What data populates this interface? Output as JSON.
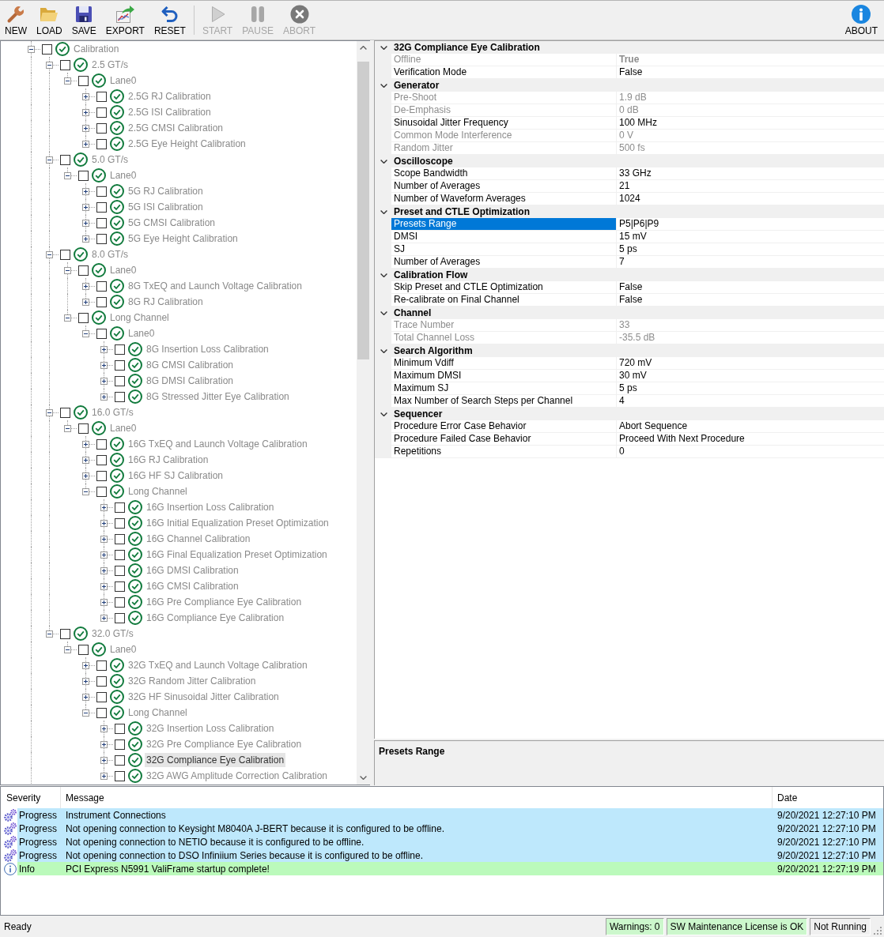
{
  "toolbar": {
    "groups": [
      [
        {
          "label": "NEW",
          "disabled": false
        },
        {
          "label": "LOAD",
          "disabled": false
        },
        {
          "label": "SAVE",
          "disabled": false
        },
        {
          "label": "EXPORT",
          "disabled": false
        },
        {
          "label": "RESET",
          "disabled": false
        }
      ],
      [
        {
          "label": "START",
          "disabled": true
        },
        {
          "label": "PAUSE",
          "disabled": true
        },
        {
          "label": "ABORT",
          "disabled": true
        }
      ]
    ],
    "right": [
      {
        "label": "ABOUT",
        "disabled": false
      }
    ]
  },
  "tree": {
    "nodes": [
      {
        "label": "Calibration",
        "checked": false,
        "expanded": true,
        "selected": false,
        "passed": true,
        "children": [
          {
            "label": "2.5 GT/s",
            "checked": false,
            "expanded": true,
            "selected": false,
            "passed": true,
            "children": [
              {
                "label": "Lane0",
                "checked": false,
                "expanded": true,
                "selected": false,
                "passed": true,
                "children": [
                  {
                    "label": "2.5G RJ Calibration",
                    "checked": false,
                    "expanded": false,
                    "selected": false,
                    "passed": true
                  },
                  {
                    "label": "2.5G ISI Calibration",
                    "checked": false,
                    "expanded": false,
                    "selected": false,
                    "passed": true
                  },
                  {
                    "label": "2.5G CMSI Calibration",
                    "checked": false,
                    "expanded": false,
                    "selected": false,
                    "passed": true
                  },
                  {
                    "label": "2.5G Eye Height Calibration",
                    "checked": false,
                    "expanded": false,
                    "selected": false,
                    "passed": true
                  }
                ]
              }
            ]
          },
          {
            "label": "5.0 GT/s",
            "checked": false,
            "expanded": true,
            "selected": false,
            "passed": true,
            "children": [
              {
                "label": "Lane0",
                "checked": false,
                "expanded": true,
                "selected": false,
                "passed": true,
                "children": [
                  {
                    "label": "5G RJ Calibration",
                    "checked": false,
                    "expanded": false,
                    "selected": false,
                    "passed": true
                  },
                  {
                    "label": "5G ISI Calibration",
                    "checked": false,
                    "expanded": false,
                    "selected": false,
                    "passed": true
                  },
                  {
                    "label": "5G CMSI Calibration",
                    "checked": false,
                    "expanded": false,
                    "selected": false,
                    "passed": true
                  },
                  {
                    "label": "5G Eye Height Calibration",
                    "checked": false,
                    "expanded": false,
                    "selected": false,
                    "passed": true
                  }
                ]
              }
            ]
          },
          {
            "label": "8.0 GT/s",
            "checked": false,
            "expanded": true,
            "selected": false,
            "passed": true,
            "children": [
              {
                "label": "Lane0",
                "checked": false,
                "expanded": true,
                "selected": false,
                "passed": true,
                "children": [
                  {
                    "label": "8G TxEQ and Launch Voltage Calibration",
                    "checked": false,
                    "expanded": false,
                    "selected": false,
                    "passed": true
                  },
                  {
                    "label": "8G RJ Calibration",
                    "checked": false,
                    "expanded": false,
                    "selected": false,
                    "passed": true
                  }
                ]
              },
              {
                "label": "Long Channel",
                "checked": false,
                "expanded": true,
                "selected": false,
                "passed": true,
                "children": [
                  {
                    "label": "Lane0",
                    "checked": false,
                    "expanded": true,
                    "selected": false,
                    "passed": true,
                    "children": [
                      {
                        "label": "8G Insertion Loss Calibration",
                        "checked": false,
                        "expanded": false,
                        "selected": false,
                        "passed": true
                      },
                      {
                        "label": "8G CMSI Calibration",
                        "checked": false,
                        "expanded": false,
                        "selected": false,
                        "passed": true
                      },
                      {
                        "label": "8G DMSI Calibration",
                        "checked": false,
                        "expanded": false,
                        "selected": false,
                        "passed": true
                      },
                      {
                        "label": "8G Stressed Jitter Eye Calibration",
                        "checked": false,
                        "expanded": false,
                        "selected": false,
                        "passed": true
                      }
                    ]
                  }
                ]
              }
            ]
          },
          {
            "label": "16.0 GT/s",
            "checked": false,
            "expanded": true,
            "selected": false,
            "passed": true,
            "children": [
              {
                "label": "Lane0",
                "checked": false,
                "expanded": true,
                "selected": false,
                "passed": true,
                "children": [
                  {
                    "label": "16G TxEQ and Launch Voltage Calibration",
                    "checked": false,
                    "expanded": false,
                    "selected": false,
                    "passed": true
                  },
                  {
                    "label": "16G RJ Calibration",
                    "checked": false,
                    "expanded": false,
                    "selected": false,
                    "passed": true
                  },
                  {
                    "label": "16G HF SJ Calibration",
                    "checked": false,
                    "expanded": false,
                    "selected": false,
                    "passed": true
                  },
                  {
                    "label": "Long Channel",
                    "checked": false,
                    "expanded": true,
                    "selected": false,
                    "passed": true,
                    "children": [
                      {
                        "label": "16G Insertion Loss Calibration",
                        "checked": false,
                        "expanded": false,
                        "selected": false,
                        "passed": true
                      },
                      {
                        "label": "16G Initial Equalization Preset Optimization",
                        "checked": false,
                        "expanded": false,
                        "selected": false,
                        "passed": true
                      },
                      {
                        "label": "16G Channel Calibration",
                        "checked": false,
                        "expanded": false,
                        "selected": false,
                        "passed": true
                      },
                      {
                        "label": "16G Final Equalization Preset Optimization",
                        "checked": false,
                        "expanded": false,
                        "selected": false,
                        "passed": true
                      },
                      {
                        "label": "16G DMSI Calibration",
                        "checked": false,
                        "expanded": false,
                        "selected": false,
                        "passed": true
                      },
                      {
                        "label": "16G CMSI Calibration",
                        "checked": false,
                        "expanded": false,
                        "selected": false,
                        "passed": true
                      },
                      {
                        "label": "16G Pre Compliance Eye Calibration",
                        "checked": false,
                        "expanded": false,
                        "selected": false,
                        "passed": true
                      },
                      {
                        "label": "16G Compliance Eye Calibration",
                        "checked": false,
                        "expanded": false,
                        "selected": false,
                        "passed": true
                      }
                    ]
                  }
                ]
              }
            ]
          },
          {
            "label": "32.0 GT/s",
            "checked": false,
            "expanded": true,
            "selected": false,
            "passed": true,
            "children": [
              {
                "label": "Lane0",
                "checked": false,
                "expanded": true,
                "selected": false,
                "passed": true,
                "children": [
                  {
                    "label": "32G TxEQ and Launch Voltage Calibration",
                    "checked": false,
                    "expanded": false,
                    "selected": false,
                    "passed": true
                  },
                  {
                    "label": "32G Random Jitter Calibration",
                    "checked": false,
                    "expanded": false,
                    "selected": false,
                    "passed": true
                  },
                  {
                    "label": "32G HF Sinusoidal Jitter Calibration",
                    "checked": false,
                    "expanded": false,
                    "selected": false,
                    "passed": true
                  },
                  {
                    "label": "Long Channel",
                    "checked": false,
                    "expanded": true,
                    "selected": false,
                    "passed": true,
                    "children": [
                      {
                        "label": "32G Insertion Loss Calibration",
                        "checked": false,
                        "expanded": false,
                        "selected": false,
                        "passed": true
                      },
                      {
                        "label": "32G Pre Compliance Eye Calibration",
                        "checked": false,
                        "expanded": false,
                        "selected": false,
                        "passed": true
                      },
                      {
                        "label": "32G Compliance Eye Calibration",
                        "checked": false,
                        "expanded": false,
                        "selected": true,
                        "passed": true
                      },
                      {
                        "label": "32G AWG Amplitude Correction Calibration",
                        "checked": false,
                        "expanded": false,
                        "selected": false,
                        "passed": true
                      }
                    ]
                  }
                ]
              }
            ]
          }
        ]
      }
    ]
  },
  "property_grid": {
    "categories": [
      {
        "name": "32G Compliance Eye Calibration",
        "expanded": true,
        "properties": [
          {
            "name": "Offline",
            "value": "True",
            "disabled": true,
            "modified": true,
            "selected": false
          },
          {
            "name": "Verification Mode",
            "value": "False",
            "disabled": false,
            "modified": false,
            "selected": false
          }
        ]
      },
      {
        "name": "Generator",
        "expanded": true,
        "properties": [
          {
            "name": "Pre-Shoot",
            "value": "1.9 dB",
            "disabled": true,
            "modified": false,
            "selected": false
          },
          {
            "name": "De-Emphasis",
            "value": "0 dB",
            "disabled": true,
            "modified": false,
            "selected": false
          },
          {
            "name": "Sinusoidal Jitter Frequency",
            "value": "100 MHz",
            "disabled": false,
            "modified": false,
            "selected": false
          },
          {
            "name": "Common Mode Interference",
            "value": "0 V",
            "disabled": true,
            "modified": false,
            "selected": false
          },
          {
            "name": "Random Jitter",
            "value": "500 fs",
            "disabled": true,
            "modified": false,
            "selected": false
          }
        ]
      },
      {
        "name": "Oscilloscope",
        "expanded": true,
        "properties": [
          {
            "name": "Scope Bandwidth",
            "value": "33 GHz",
            "disabled": false,
            "modified": false,
            "selected": false
          },
          {
            "name": "Number of Averages",
            "value": "21",
            "disabled": false,
            "modified": false,
            "selected": false
          },
          {
            "name": "Number of Waveform Averages",
            "value": "1024",
            "disabled": false,
            "modified": false,
            "selected": false
          }
        ]
      },
      {
        "name": "Preset and CTLE Optimization",
        "expanded": true,
        "properties": [
          {
            "name": "Presets Range",
            "value": "P5|P6|P9",
            "disabled": false,
            "modified": false,
            "selected": true
          },
          {
            "name": "DMSI",
            "value": "15 mV",
            "disabled": false,
            "modified": false,
            "selected": false
          },
          {
            "name": "SJ",
            "value": "5 ps",
            "disabled": false,
            "modified": false,
            "selected": false
          },
          {
            "name": "Number of Averages",
            "value": "7",
            "disabled": false,
            "modified": false,
            "selected": false
          }
        ]
      },
      {
        "name": "Calibration Flow",
        "expanded": true,
        "properties": [
          {
            "name": "Skip Preset and CTLE Optimization",
            "value": "False",
            "disabled": false,
            "modified": false,
            "selected": false
          },
          {
            "name": "Re-calibrate on Final Channel",
            "value": "False",
            "disabled": false,
            "modified": false,
            "selected": false
          }
        ]
      },
      {
        "name": "Channel",
        "expanded": true,
        "properties": [
          {
            "name": "Trace Number",
            "value": "33",
            "disabled": true,
            "modified": false,
            "selected": false
          },
          {
            "name": "Total Channel Loss",
            "value": "-35.5 dB",
            "disabled": true,
            "modified": false,
            "selected": false
          }
        ]
      },
      {
        "name": "Search Algorithm",
        "expanded": true,
        "properties": [
          {
            "name": "Minimum Vdiff",
            "value": "720 mV",
            "disabled": false,
            "modified": false,
            "selected": false
          },
          {
            "name": "Maximum DMSI",
            "value": "30 mV",
            "disabled": false,
            "modified": false,
            "selected": false
          },
          {
            "name": "Maximum SJ",
            "value": "5 ps",
            "disabled": false,
            "modified": false,
            "selected": false
          },
          {
            "name": "Max Number of Search Steps per Channel",
            "value": "4",
            "disabled": false,
            "modified": false,
            "selected": false
          }
        ]
      },
      {
        "name": "Sequencer",
        "expanded": true,
        "properties": [
          {
            "name": "Procedure Error Case Behavior",
            "value": "Abort Sequence",
            "disabled": false,
            "modified": false,
            "selected": false
          },
          {
            "name": "Procedure Failed Case Behavior",
            "value": "Proceed With Next Procedure",
            "disabled": false,
            "modified": false,
            "selected": false
          },
          {
            "name": "Repetitions",
            "value": "0",
            "disabled": false,
            "modified": false,
            "selected": false
          }
        ]
      }
    ]
  },
  "description": {
    "title": "Presets Range"
  },
  "log": {
    "columns": [
      "Severity",
      "Message",
      "Date"
    ],
    "rows": [
      {
        "kind": "progress",
        "color": "#bee8fc",
        "severity": "Progress",
        "message": "Instrument Connections",
        "date": "9/20/2021 12:27:10 PM"
      },
      {
        "kind": "progress",
        "color": "#bee8fc",
        "severity": "Progress",
        "message": "Not opening connection to Keysight M8040A J-BERT because it is configured to be offline.",
        "date": "9/20/2021 12:27:10 PM"
      },
      {
        "kind": "progress",
        "color": "#bee8fc",
        "severity": "Progress",
        "message": "Not opening connection to NETIO because it is configured to be offline.",
        "date": "9/20/2021 12:27:10 PM"
      },
      {
        "kind": "progress",
        "color": "#bee8fc",
        "severity": "Progress",
        "message": "Not opening connection to DSO Infiniium Series because it is configured to be offline.",
        "date": "9/20/2021 12:27:10 PM"
      },
      {
        "kind": "info",
        "color": "#bbfabb",
        "severity": "Info",
        "message": "PCI Express N5991 ValiFrame startup complete!",
        "date": "9/20/2021 12:27:19 PM"
      }
    ]
  },
  "status_bar": {
    "text": "Ready",
    "panels": [
      {
        "text": "Warnings: 0",
        "color": "#ccf7cc"
      },
      {
        "text": "SW Maintenance License is OK",
        "color": "#ccf7cc"
      },
      {
        "text": "Not Running",
        "color": "#f0f0f0"
      }
    ]
  }
}
